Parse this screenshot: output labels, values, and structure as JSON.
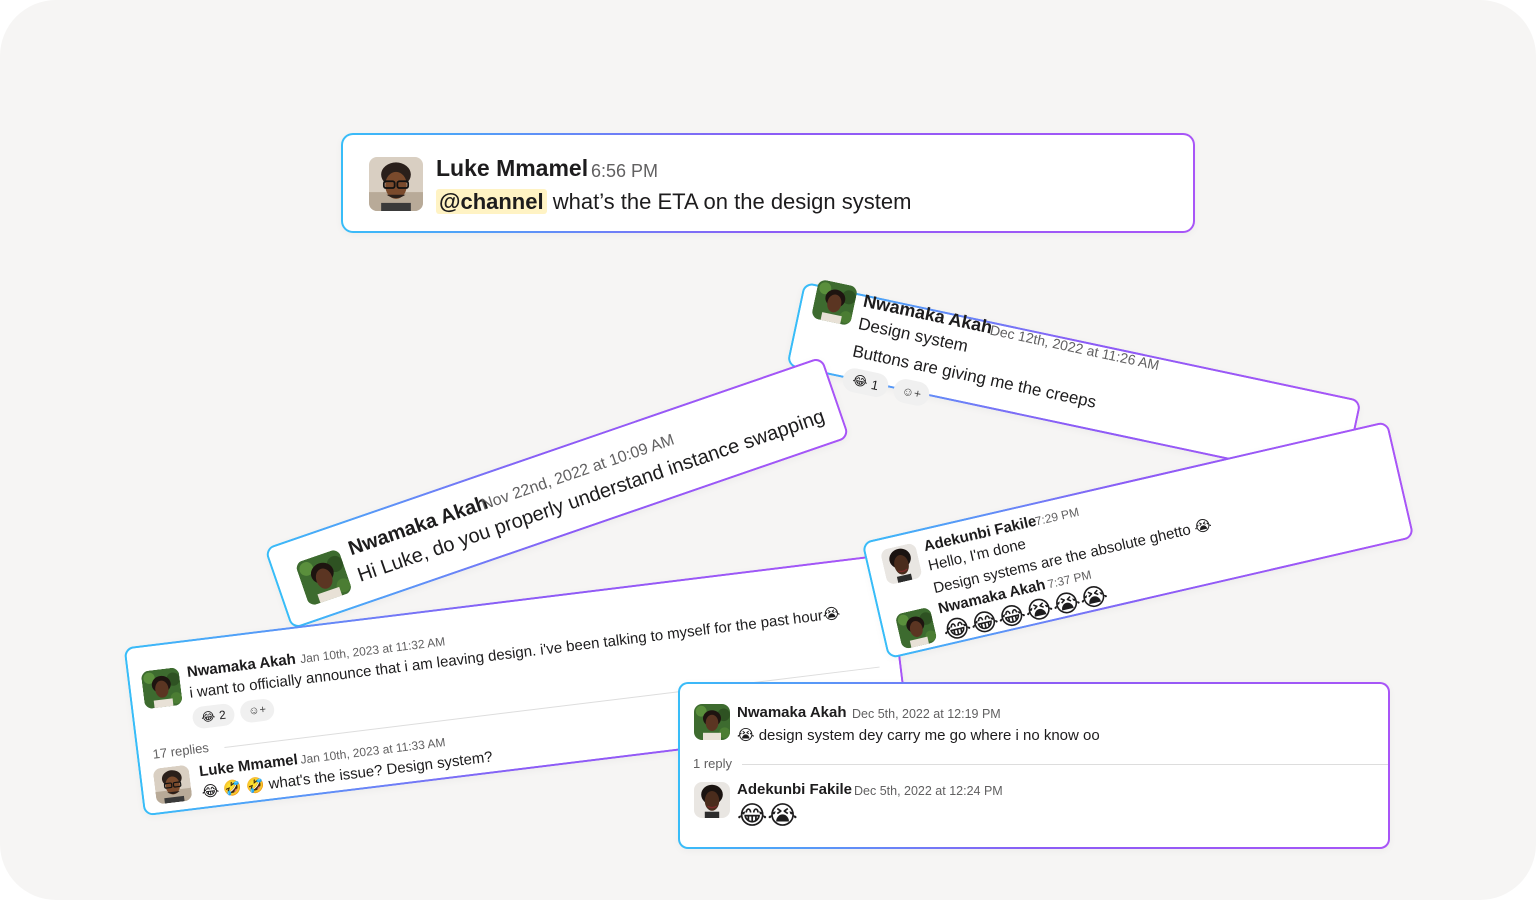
{
  "colors": {
    "background": "#f6f5f4",
    "card": "#ffffff",
    "border_start": "#38bdf8",
    "border_end": "#a855f7",
    "mention_bg": "#fff3c4",
    "timestamp": "#616061"
  },
  "icons": {
    "laugh": "😂",
    "sob": "😭",
    "rofl": "🤣",
    "add_reaction": "☺+"
  },
  "cards": {
    "top": {
      "author": "Luke Mmamel",
      "time": "6:56 PM",
      "mention": "@channel",
      "message": "what’s the ETA on the design system"
    },
    "design_system": {
      "author": "Nwamaka Akah",
      "time": "Dec 12th, 2022 at 11:26 AM",
      "line1": "Design system",
      "line2": "Buttons are giving me the creeps",
      "reaction_count": "1"
    },
    "instance_swapping": {
      "author": "Nwamaka Akah",
      "time": "Nov 22nd, 2022 at 10:09 AM",
      "message": "Hi Luke, do you properly understand instance swapping"
    },
    "ghetto": {
      "author1": "Adekunbi Fakile",
      "time1": "7:29 PM",
      "line1": "Hello, I'm done",
      "line2": "Design systems are the absolute ghetto",
      "author2": "Nwamaka Akah",
      "time2": "7:37 PM"
    },
    "leaving": {
      "author": "Nwamaka Akah",
      "time": "Jan 10th, 2023 at 11:32 AM",
      "message": "i want to officially announce that i am leaving design. i've been talking to myself for the past hour",
      "reaction_count": "2",
      "replies": "17 replies",
      "reply_author": "Luke Mmamel",
      "reply_time": "Jan 10th, 2023 at 11:33 AM",
      "reply_message": "what's the issue? Design system?"
    },
    "dey_carry": {
      "author": "Nwamaka Akah",
      "time": "Dec 5th, 2022 at 12:19 PM",
      "message": "design system dey carry me go where i no know oo",
      "replies": "1 reply",
      "reply_author": "Adekunbi Fakile",
      "reply_time": "Dec 5th, 2022 at 12:24 PM"
    }
  }
}
